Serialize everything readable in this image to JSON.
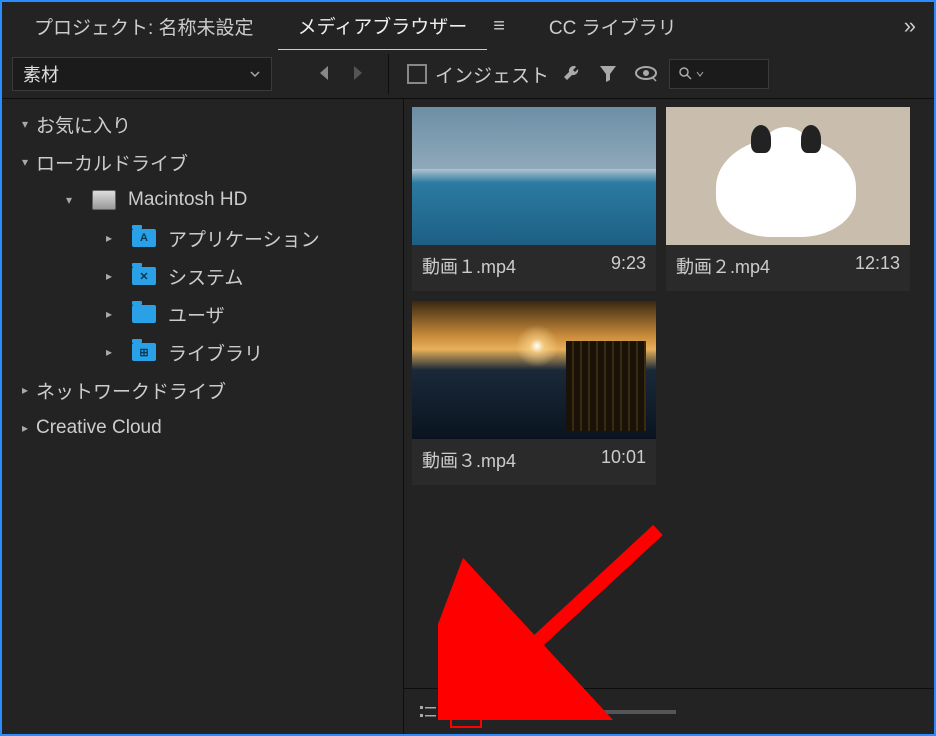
{
  "tabs": {
    "project": "プロジェクト: 名称未設定",
    "media_browser": "メディアブラウザー",
    "cc_libraries": "CC ライブラリ"
  },
  "toolbar": {
    "source_dropdown": "素材",
    "ingest_label": "インジェスト"
  },
  "tree": {
    "favorites": "お気に入り",
    "local_drives": "ローカルドライブ",
    "mac_hd": "Macintosh HD",
    "applications": "アプリケーション",
    "system": "システム",
    "users": "ユーザ",
    "library": "ライブラリ",
    "network_drives": "ネットワークドライブ",
    "creative_cloud": "Creative Cloud"
  },
  "clips": [
    {
      "name": "動画１.mp4",
      "duration": "9:23"
    },
    {
      "name": "動画２.mp4",
      "duration": "12:13"
    },
    {
      "name": "動画３.mp4",
      "duration": "10:01"
    }
  ]
}
